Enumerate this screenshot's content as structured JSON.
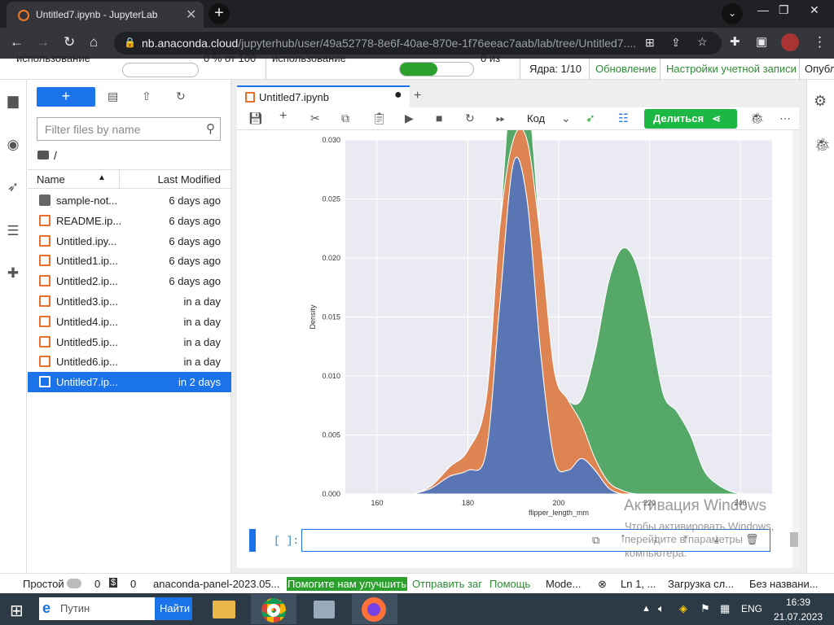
{
  "browser": {
    "tab_title": "Untitled7.ipynb - JupyterLab",
    "url_host": "nb.anaconda.cloud",
    "url_path": "/jupyterhub/user/49a52778-8e6f-40ae-870e-1f76eeac7aab/lab/tree/Untitled7...."
  },
  "topbar": {
    "usage1": "использование",
    "pct1": "0 % от 100",
    "usage2": "использование",
    "of": "0 из",
    "kernels": "Ядра: 1/10",
    "update": "Обновление",
    "account": "Настройки учетной записи",
    "publish": "Опубл"
  },
  "filebrowser": {
    "filter_placeholder": "Filter files by name",
    "path": "/",
    "col_name": "Name",
    "col_modified": "Last Modified",
    "files": [
      {
        "name": "sample-not...",
        "modified": "6 days ago"
      },
      {
        "name": "README.ip...",
        "modified": "6 days ago"
      },
      {
        "name": "Untitled.ipy...",
        "modified": "6 days ago"
      },
      {
        "name": "Untitled1.ip...",
        "modified": "6 days ago"
      },
      {
        "name": "Untitled2.ip...",
        "modified": "6 days ago"
      },
      {
        "name": "Untitled3.ip...",
        "modified": "in a day"
      },
      {
        "name": "Untitled4.ip...",
        "modified": "in a day"
      },
      {
        "name": "Untitled5.ip...",
        "modified": "in a day"
      },
      {
        "name": "Untitled6.ip...",
        "modified": "in a day"
      },
      {
        "name": "Untitled7.ip...",
        "modified": "in 2 days"
      }
    ]
  },
  "notebook": {
    "tab": "Untitled7.ipynb",
    "cell_type": "Код",
    "share": "Делиться",
    "prompt": "[ ]:"
  },
  "chart_data": {
    "type": "area",
    "title": "",
    "xlabel": "flipper_length_mm",
    "ylabel": "Density",
    "xticks": [
      160,
      180,
      200,
      220,
      240
    ],
    "yticks": [
      "0.000",
      "0.005",
      "0.010",
      "0.015",
      "0.020",
      "0.025",
      "0.030"
    ],
    "xlim": [
      153,
      247
    ],
    "ylim": [
      0,
      0.03
    ],
    "stacked": true,
    "x": [
      168,
      172,
      176,
      180,
      184,
      187,
      190,
      193,
      196,
      199,
      202,
      205,
      208,
      211,
      214,
      217,
      220,
      223,
      226,
      229,
      232,
      235,
      238,
      241
    ],
    "series": [
      {
        "color": "#5975b4",
        "values": [
          0,
          0.0005,
          0.0015,
          0.002,
          0.0035,
          0.016,
          0.028,
          0.025,
          0.012,
          0.003,
          0.002,
          0.003,
          0.002,
          0.0005,
          0,
          0,
          0,
          0,
          0,
          0,
          0,
          0,
          0,
          0
        ]
      },
      {
        "color": "#dd8452",
        "values": [
          0,
          0.0002,
          0.0008,
          0.0017,
          0.0045,
          0.0065,
          0.0083,
          0.0098,
          0.0096,
          0.0075,
          0.006,
          0.003,
          0.001,
          0.0005,
          0.0003,
          0,
          0,
          0,
          0,
          0,
          0,
          0,
          0,
          0
        ]
      },
      {
        "color": "#55a868",
        "values": [
          0,
          0,
          0,
          0,
          0,
          0,
          0,
          0,
          0,
          0,
          0,
          0.002,
          0.009,
          0.017,
          0.0205,
          0.0195,
          0.0145,
          0.0085,
          0.007,
          0.005,
          0.002,
          0.0008,
          0.0002,
          0
        ]
      }
    ]
  },
  "status": {
    "mode": "Простой",
    "n1": "0",
    "n2": "0",
    "panel": "anaconda-panel-2023.05...",
    "help": "Помогите нам улучшить",
    "send": "Отправить заг",
    "helpme": "Помощь",
    "mode2": "Mode...",
    "ln": "Ln 1, ...",
    "loading": "Загрузка сл...",
    "unnamed": "Без названи..."
  },
  "watermark": {
    "title": "Активация Windows",
    "text": "Чтобы активировать Windows, перейдите в параметры компьютера."
  },
  "taskbar": {
    "search": "Путин",
    "find": "Найти",
    "lang": "ENG",
    "time": "16:39",
    "date": "21.07.2023"
  }
}
